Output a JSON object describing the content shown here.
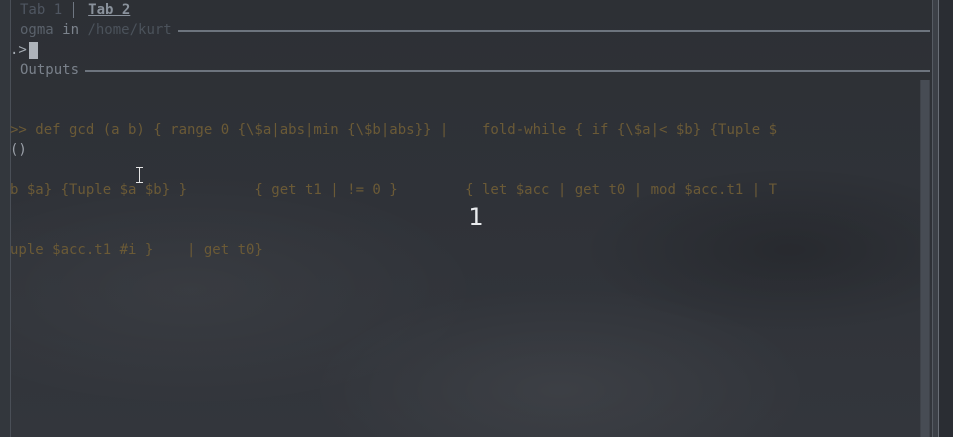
{
  "tabs": [
    {
      "label": "Tab 1",
      "active": false
    },
    {
      "label": "Tab 2",
      "active": true
    }
  ],
  "status": {
    "user": "ogma",
    "in": "in",
    "path": "/home/kurt"
  },
  "prompt": {
    "symbol": ".>",
    "input": ""
  },
  "outputs": {
    "label": "Outputs",
    "lines": [
      ">> def gcd (a b) { range 0 {\\$a|abs|min {\\$b|abs}} |    fold-while { if {\\$a|< $b} {Tuple $",
      "b $a} {Tuple $a $b} }        { get t1 | != 0 }        { let $acc | get t0 | mod $acc.t1 | T",
      "uple $acc.t1 #i }    | get t0}"
    ],
    "result": "()"
  },
  "overlay": {
    "number": "1"
  },
  "icons": {
    "cursor": "text-cursor-icon"
  },
  "colors": {
    "background": "#2c3036",
    "output_text": "#6b5a36",
    "rule": "#6d747e"
  }
}
